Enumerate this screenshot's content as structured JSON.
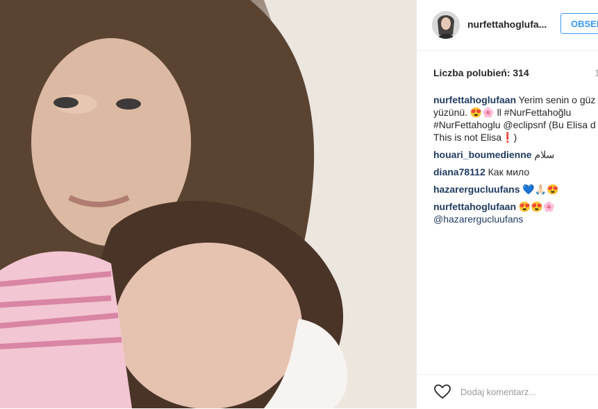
{
  "post": {
    "username": "nurfettahoglufa...",
    "follow_label": "OBSERWUJ",
    "likes_label": "Liczba polubień: 314",
    "time_label": "1"
  },
  "comments": [
    {
      "user": "nurfettahoglufaan",
      "lines": [
        "Yerim senin o güz",
        "yüzünü. 😍🌸 ll #NurFettahoğlu",
        "#NurFettahoglu @eclipsnf (Bu Elisa d",
        "This is not Elisa❗)"
      ]
    },
    {
      "user": "houari_boumedienne",
      "text": "سلام"
    },
    {
      "user": "diana78112",
      "text": "Как мило"
    },
    {
      "user": "hazarergucluufans",
      "text": "💙🙏🏻😍"
    },
    {
      "user": "nurfettahoglufaan",
      "text": "😍😍🌸",
      "line2": "@hazarergucluufans"
    }
  ],
  "footer": {
    "placeholder": "Dodaj komentarz..."
  },
  "icons": {
    "like": "heart-icon"
  },
  "colors": {
    "accent": "#3897f0",
    "user": "#1e3a5f"
  }
}
